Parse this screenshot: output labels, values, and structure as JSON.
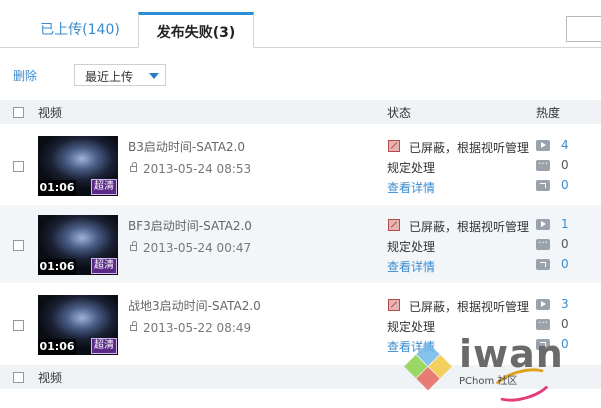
{
  "tabs": [
    {
      "label": "已上传(140)"
    },
    {
      "label": "发布失败(3)"
    }
  ],
  "toolbar": {
    "delete_label": "删除",
    "sort_selected": "最近上传"
  },
  "table": {
    "headers": {
      "video": "视频",
      "status": "状态",
      "heat": "热度"
    },
    "footer_label": "视频"
  },
  "rows": [
    {
      "duration": "01:06",
      "quality": "超清",
      "title": "B3启动时间-SATA2.0",
      "date": "2013-05-24 08:53",
      "status": "已屏蔽，根据视听管理规定处理",
      "detail_link": "查看详情",
      "plays": "4",
      "comments": "0",
      "shares": "0"
    },
    {
      "duration": "01:06",
      "quality": "超清",
      "title": "BF3启动时间-SATA2.0",
      "date": "2013-05-24 00:47",
      "status": "已屏蔽，根据视听管理规定处理",
      "detail_link": "查看详情",
      "plays": "1",
      "comments": "0",
      "shares": "0"
    },
    {
      "duration": "01:06",
      "quality": "超清",
      "title": "战地3启动时间-SATA2.0",
      "date": "2013-05-22 08:49",
      "status": "已屏蔽，根据视听管理规定处理",
      "detail_link": "查看详情",
      "plays": "3",
      "comments": "0",
      "shares": "0"
    }
  ],
  "watermark": {
    "text": "iwan",
    "sub": "PChom  社区"
  },
  "colors": {
    "accent": "#3a8bcf",
    "tab_active_border": "#2b8dd6",
    "row_alt_bg": "#f2f6f9",
    "header_bg": "#eff3f6",
    "hd_badge": "#5b2a86"
  }
}
